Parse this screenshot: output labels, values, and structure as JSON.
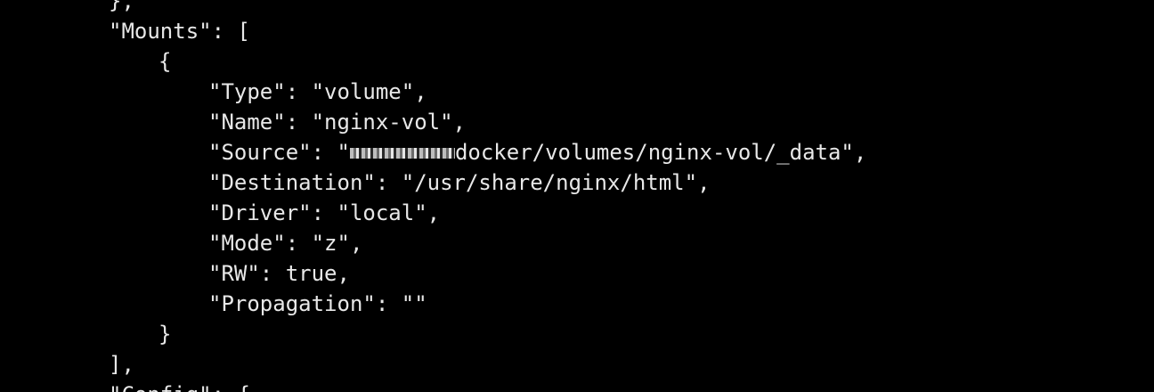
{
  "terminal": {
    "lines": [
      {
        "id": "prev-close",
        "text": "},",
        "indent": 1
      },
      {
        "id": "mounts-key",
        "text": "\"Mounts\": [",
        "indent": 1
      },
      {
        "id": "open-brace",
        "text": "{",
        "indent": 2
      },
      {
        "id": "type",
        "text": "\"Type\": \"volume\",",
        "indent": 3
      },
      {
        "id": "name",
        "text": "\"Name\": \"nginx-vol\",",
        "indent": 3
      },
      {
        "id": "source",
        "prefix": "\"Source\": \"",
        "suffix": "docker/volumes/nginx-vol/_data\",",
        "indent": 3,
        "redacted": true
      },
      {
        "id": "destination",
        "text": "\"Destination\": \"/usr/share/nginx/html\",",
        "indent": 3
      },
      {
        "id": "driver",
        "text": "\"Driver\": \"local\",",
        "indent": 3
      },
      {
        "id": "mode",
        "text": "\"Mode\": \"z\",",
        "indent": 3
      },
      {
        "id": "rw",
        "text": "\"RW\": true,",
        "indent": 3
      },
      {
        "id": "propagation",
        "text": "\"Propagation\": \"\"",
        "indent": 3
      },
      {
        "id": "close-brace",
        "text": "}",
        "indent": 2
      },
      {
        "id": "close-bracket",
        "text": "],",
        "indent": 1
      },
      {
        "id": "config-key",
        "text": "\"Config\": {",
        "indent": 1
      }
    ]
  },
  "colors": {
    "background": "#000000",
    "text": "#e8e8e8"
  }
}
